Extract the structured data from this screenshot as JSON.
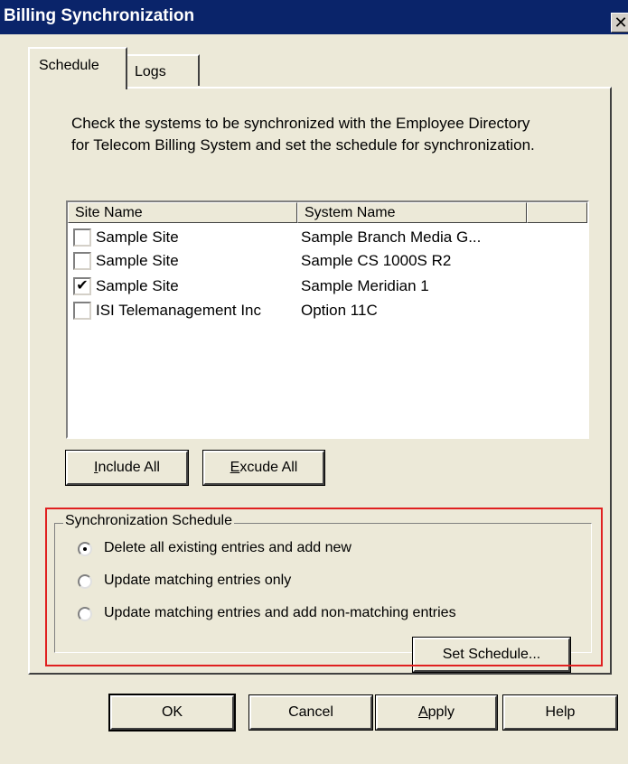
{
  "window": {
    "title": "Billing Synchronization",
    "close_glyph": "✕"
  },
  "tabs": [
    {
      "label": "Schedule",
      "active": true
    },
    {
      "label": "Logs",
      "active": false
    }
  ],
  "instructions": "Check the systems to be synchronized with the Employee Directory for Telecom Billing System and set the schedule for synchronization.",
  "systems_list": {
    "columns": [
      "Site Name",
      "System Name",
      ""
    ],
    "rows": [
      {
        "checked": false,
        "site": "Sample Site",
        "system": "Sample Branch Media G..."
      },
      {
        "checked": false,
        "site": "Sample Site",
        "system": "Sample CS 1000S R2"
      },
      {
        "checked": true,
        "site": "Sample Site",
        "system": "Sample Meridian 1"
      },
      {
        "checked": false,
        "site": "ISI Telemanagement Inc",
        "system": "Option 11C"
      }
    ]
  },
  "buttons": {
    "include_all": {
      "mnemonic": "I",
      "rest": "nclude All"
    },
    "exclude_all": {
      "mnemonic": "E",
      "rest": "xcude All"
    },
    "set_schedule": "Set Schedule...",
    "ok": "OK",
    "cancel": "Cancel",
    "apply": {
      "mnemonic": "A",
      "rest": "pply"
    },
    "help": "Help"
  },
  "schedule_group": {
    "legend": "Synchronization Schedule",
    "options": [
      {
        "label": "Delete all existing entries and add new",
        "selected": true
      },
      {
        "label": "Update matching entries only",
        "selected": false
      },
      {
        "label": "Update matching entries and add non-matching entries",
        "selected": false
      }
    ]
  },
  "colors": {
    "titlebar": "#0a246a",
    "dialog_face": "#ece9d8",
    "highlight_box": "#e02020"
  }
}
